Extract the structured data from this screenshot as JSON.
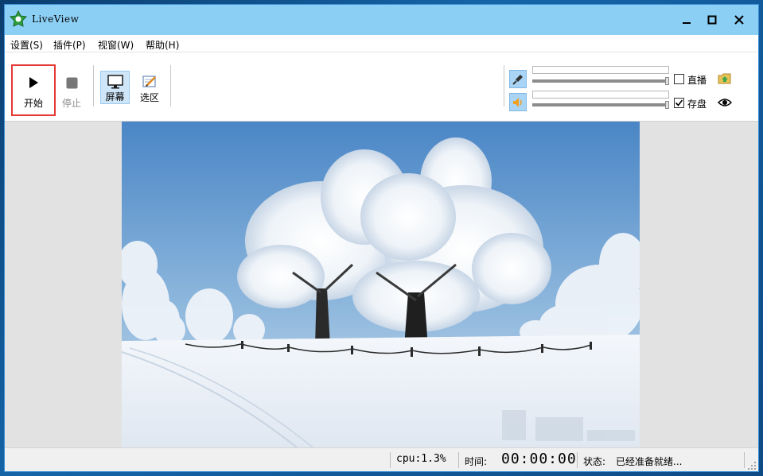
{
  "window": {
    "title": "LiveView"
  },
  "menu": [
    {
      "label": "设置(S)"
    },
    {
      "label": "插件(P)"
    },
    {
      "label": "视窗(W)"
    },
    {
      "label": "帮助(H)"
    }
  ],
  "toolbar": {
    "start_label": "开始",
    "stop_label": "停止",
    "screen_label": "屏幕",
    "region_label": "选区",
    "mic_volume_level": 1.0,
    "speaker_volume_level": 1.0,
    "live_label": "直播",
    "live_checked": false,
    "save_label": "存盘",
    "save_checked": true
  },
  "status": {
    "cpu": "cpu:1.3%",
    "time_label": "时间:",
    "time_value": "00:00:00",
    "state_label": "状态:",
    "state_value": "已经准备就绪..."
  },
  "colors": {
    "titlebar": "#8ccff5",
    "highlight_border": "#e53935",
    "selected_button": "#cfe6f8"
  }
}
